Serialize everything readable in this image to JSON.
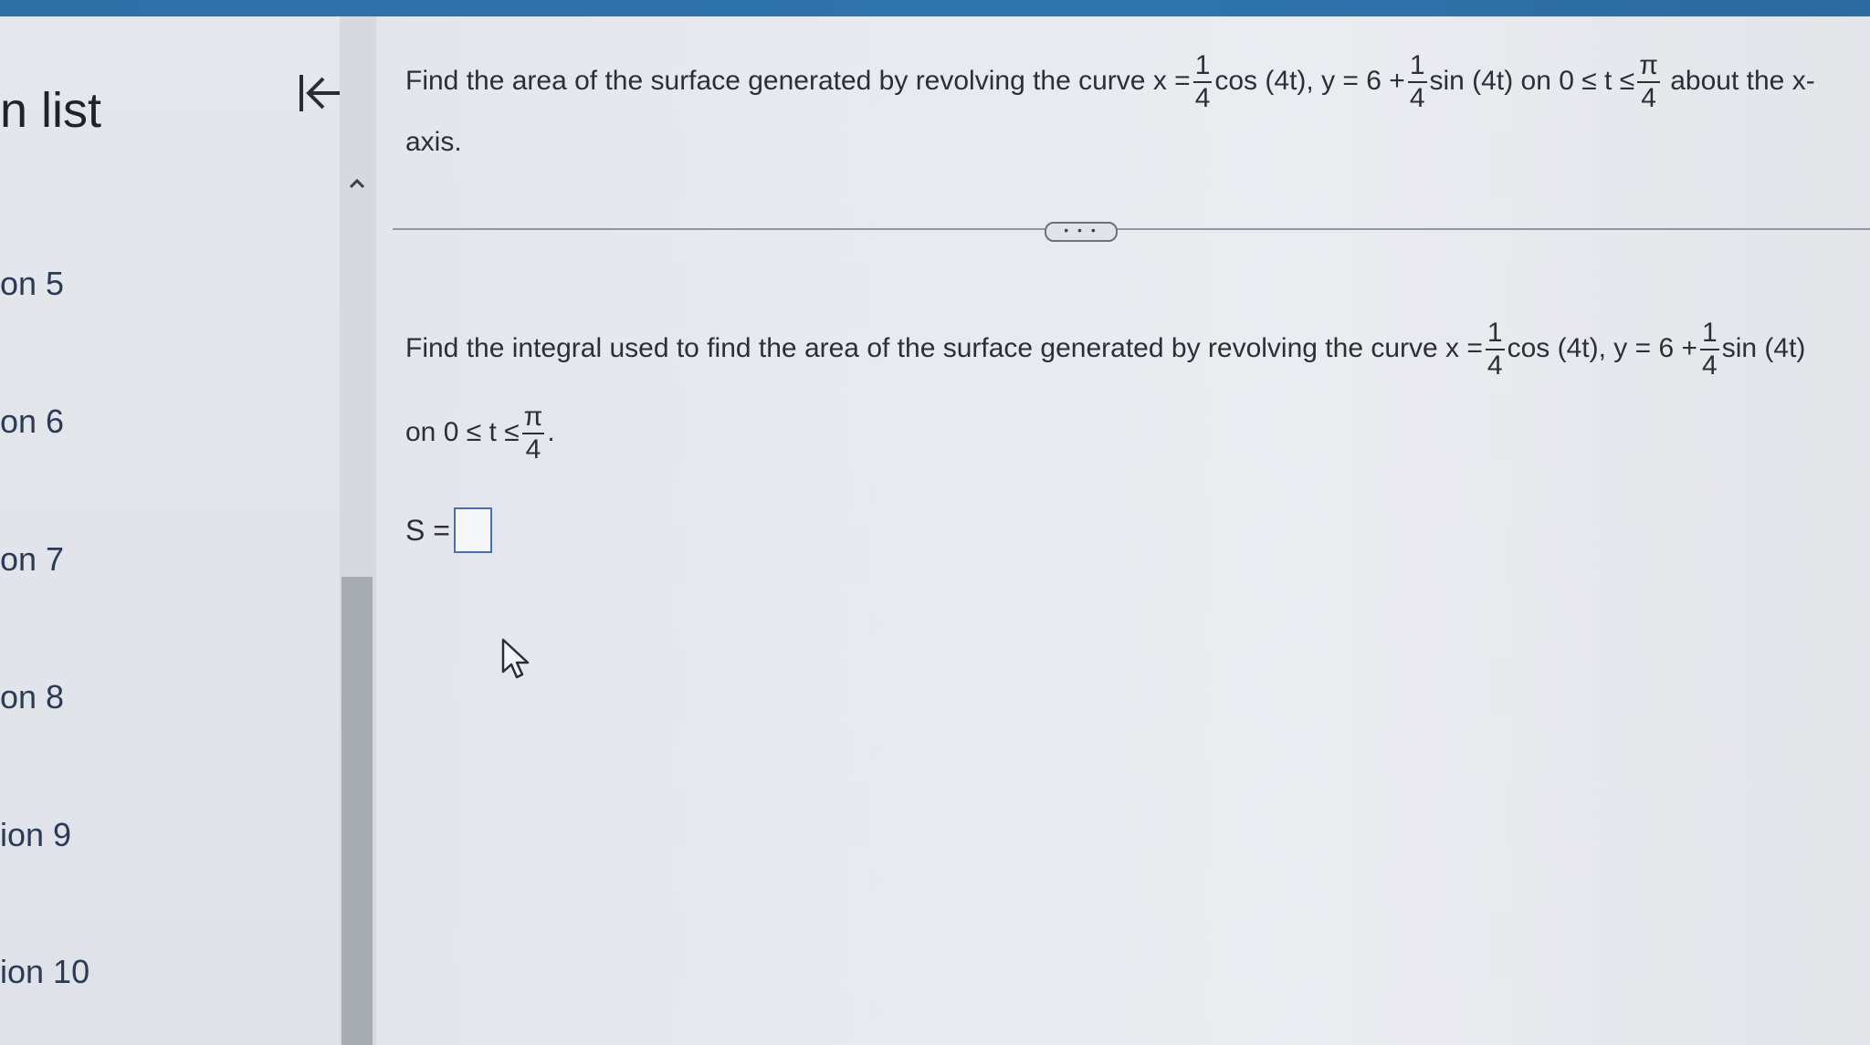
{
  "colors": {
    "top_bar": "#2e6fa6",
    "sidebar_bg": "#e4e7ec",
    "content_bg": "#e9ebf0",
    "scroll_thumb": "#a7abb2",
    "answer_box_border": "#4a6fb0"
  },
  "sidebar": {
    "title": "n list",
    "collapse_icon": "collapse-left-arrow-icon",
    "items": [
      {
        "label": "on 5"
      },
      {
        "label": "on 6"
      },
      {
        "label": "on 7"
      },
      {
        "label": "on 8"
      },
      {
        "label": "ion 9"
      },
      {
        "label": "ion 10"
      }
    ]
  },
  "question": {
    "text_a": "Find the area of the surface generated by revolving the curve",
    "x_expr_prefix": "x =",
    "frac_num": "1",
    "frac_den": "4",
    "x_expr_suffix": "cos (4t),",
    "y_expr_prefix": "y = 6 +",
    "y_expr_suffix": "sin (4t)",
    "on_text": "on 0 ≤ t ≤",
    "pi": "π",
    "text_b": "about the x-axis."
  },
  "divider": {
    "more_label": "• • •"
  },
  "subquestion": {
    "text_a": "Find the integral used to find the area of the surface generated by revolving the curve",
    "x_expr_prefix": "x =",
    "frac_num": "1",
    "frac_den": "4",
    "x_expr_suffix": "cos (4t),",
    "y_expr_prefix": "y = 6 +",
    "y_expr_suffix": "sin (4t)",
    "on_text": "on 0 ≤ t ≤",
    "pi": "π",
    "end_period": "."
  },
  "answer": {
    "label": "S =",
    "value": ""
  },
  "pointer_icon": "mouse-pointer-icon"
}
